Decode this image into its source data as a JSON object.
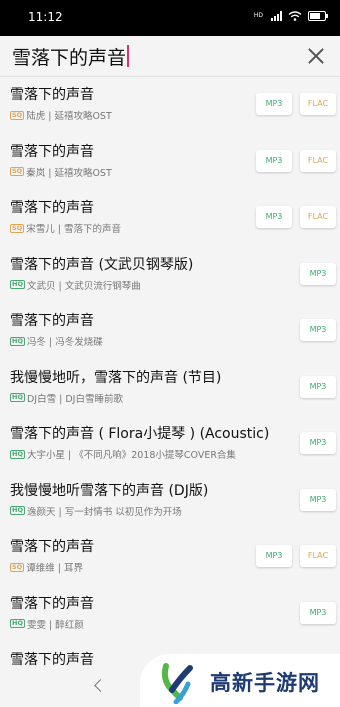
{
  "status_bar": {
    "time": "11:12",
    "network_tag": "HD"
  },
  "search": {
    "query": "雪落下的声音"
  },
  "results": [
    {
      "title": "雪落下的声音",
      "quality": "SQ",
      "subtitle": "陆虎 | 延禧攻略OST",
      "buttons": [
        "MP3",
        "FLAC"
      ]
    },
    {
      "title": "雪落下的声音",
      "quality": "SQ",
      "subtitle": "秦岚 | 延禧攻略OST",
      "buttons": [
        "MP3",
        "FLAC"
      ]
    },
    {
      "title": "雪落下的声音",
      "quality": "SQ",
      "subtitle": "宋雪儿 | 雪落下的声音",
      "buttons": [
        "MP3",
        "FLAC"
      ]
    },
    {
      "title": "雪落下的声音 (文武贝钢琴版)",
      "quality": "HQ",
      "subtitle": "文武贝 | 文武贝流行钢琴曲",
      "buttons": [
        "MP3"
      ]
    },
    {
      "title": "雪落下的声音",
      "quality": "HQ",
      "subtitle": "冯冬 | 冯冬发烧碟",
      "buttons": [
        "MP3"
      ]
    },
    {
      "title": "我慢慢地听，雪落下的声音 (节目)",
      "quality": "HQ",
      "subtitle": "DJ白雪 | DJ白雪睡前歌",
      "buttons": [
        "MP3"
      ]
    },
    {
      "title": "雪落下的声音 ( Flora小提琴 ) (Acoustic)",
      "quality": "HQ",
      "subtitle": "大宇小星 | 《不同凡响》2018小提琴COVER合集",
      "buttons": [
        "MP3"
      ]
    },
    {
      "title": "我慢慢地听雪落下的声音 (DJ版)",
      "quality": "HQ",
      "subtitle": "逸颜天 | 写一封情书 以初见作为开场",
      "buttons": [
        "MP3"
      ]
    },
    {
      "title": "雪落下的声音",
      "quality": "SQ",
      "subtitle": "谭维维 | 耳界",
      "buttons": [
        "MP3",
        "FLAC"
      ]
    },
    {
      "title": "雪落下的声音",
      "quality": "HQ",
      "subtitle": "雯雯 | 醉红颜",
      "buttons": [
        "MP3"
      ]
    },
    {
      "title": "雪落下的声音",
      "quality": "",
      "subtitle": "",
      "buttons": []
    }
  ],
  "watermark": {
    "text": "高新手游网"
  },
  "colors": {
    "accent_mp3": "#3daa6f",
    "accent_flac": "#d9a654",
    "caret": "#e0336a",
    "brand_blue": "#1f3b74",
    "brand_green": "#54b848"
  },
  "icons": {
    "close": "close-icon",
    "back": "back-chevron-icon",
    "signal": "signal-icon",
    "wifi": "wifi-icon",
    "battery": "battery-icon"
  }
}
